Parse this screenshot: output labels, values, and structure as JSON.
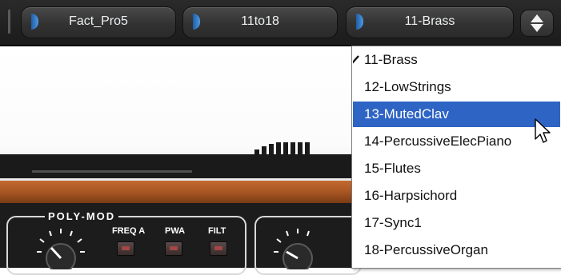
{
  "preset_bar": {
    "bank": "Fact_Pro5",
    "group": "11to18",
    "patch": "11-Brass"
  },
  "menu": {
    "checked_index": 0,
    "highlighted_index": 2,
    "items": [
      "11-Brass",
      "12-LowStrings",
      "13-MutedClav",
      "14-PercussiveElecPiano",
      "15-Flutes",
      "16-Harpsichord",
      "17-Sync1",
      "18-PercussiveOrgan"
    ]
  },
  "synth_panel": {
    "section_title": "POLY-MOD",
    "buttons": [
      "FREQ A",
      "PWA",
      "FILT"
    ]
  },
  "colors": {
    "bar_bg": "#1b1b1b",
    "field_bg": "#3a3a3a",
    "knob_accent": "#3f86d6",
    "wood": "#b35c26",
    "menu_highlight": "#2e64c4",
    "led_red": "#a54646"
  }
}
